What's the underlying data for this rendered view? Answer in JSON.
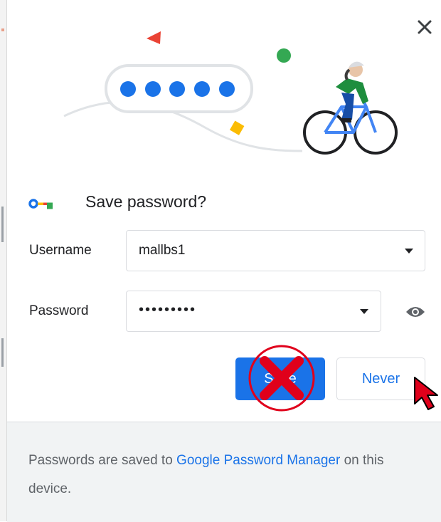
{
  "dialog": {
    "title": "Save password?",
    "close_icon": "close-icon",
    "key_icon": "key-icon"
  },
  "username": {
    "label": "Username",
    "value": "mallbs1"
  },
  "password": {
    "label": "Password",
    "value": "•••••••••"
  },
  "buttons": {
    "save_label": "Save",
    "never_label": "Never"
  },
  "footer": {
    "text_before": "Passwords are saved to ",
    "link_text": "Google Password Manager",
    "text_after": " on this device."
  },
  "colors": {
    "accent": "#1a73e8",
    "footer_bg": "#f1f3f4",
    "annotation_red": "#e0001b"
  }
}
